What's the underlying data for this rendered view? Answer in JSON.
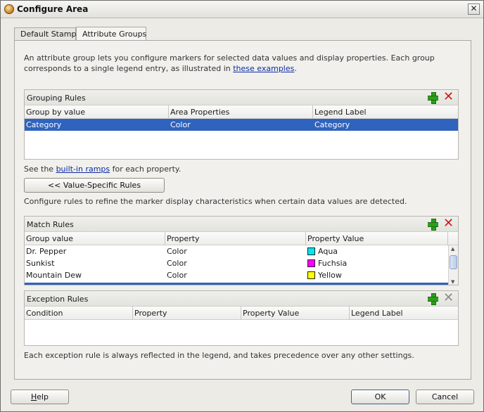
{
  "window": {
    "title": "Configure Area",
    "close_glyph": "✕"
  },
  "tabs": [
    {
      "label": "Default Stamp"
    },
    {
      "label": "Attribute Groups"
    }
  ],
  "intro": {
    "text": "An attribute group lets you configure markers for selected data values and display properties. Each group corresponds to a single legend entry, as illustrated in ",
    "link": "these examples",
    "suffix": "."
  },
  "grouping_rules": {
    "title": "Grouping Rules",
    "columns": [
      "Group by value",
      "Area Properties",
      "Legend Label"
    ],
    "rows": [
      [
        "Category",
        "Color",
        "Category"
      ]
    ]
  },
  "ramps_note": {
    "prefix": "See the ",
    "link": "built-in ramps",
    "suffix": " for each property."
  },
  "value_specific_button": "<< Value-Specific Rules",
  "configure_note": "Configure rules to refine the marker display characteristics when certain data values are detected.",
  "match_rules": {
    "title": "Match Rules",
    "columns": [
      "Group value",
      "Property",
      "Property Value"
    ],
    "rows": [
      {
        "group": "Dr. Pepper",
        "property": "Color",
        "value": "Aqua",
        "swatch": "#00e5ef"
      },
      {
        "group": "Sunkist",
        "property": "Color",
        "value": "Fuchsia",
        "swatch": "#ff00ff"
      },
      {
        "group": "Mountain Dew",
        "property": "Color",
        "value": "Yellow",
        "swatch": "#ffff00"
      }
    ]
  },
  "exception_rules": {
    "title": "Exception Rules",
    "columns": [
      "Condition",
      "Property",
      "Property Value",
      "Legend Label"
    ]
  },
  "exception_note": "Each exception rule is always reflected in the legend, and takes precedence over any other settings.",
  "footer": {
    "help_mnemonic": "H",
    "help_rest": "elp",
    "ok": "OK",
    "cancel": "Cancel"
  },
  "colors": {
    "selection": "#2f63bd",
    "link": "#0b2ca5",
    "add": "#2e9d1c",
    "delete": "#d21a1a"
  }
}
